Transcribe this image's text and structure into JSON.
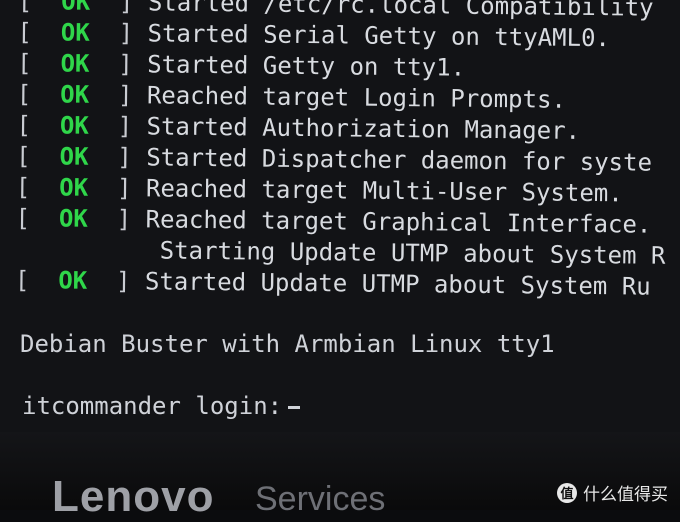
{
  "boot_lines": [
    {
      "status": "OK",
      "message": "Started /etc/rc.local Compatibility"
    },
    {
      "status": "OK",
      "message": "Started Serial Getty on ttyAML0."
    },
    {
      "status": "OK",
      "message": "Started Getty on tty1."
    },
    {
      "status": "OK",
      "message": "Reached target Login Prompts."
    },
    {
      "status": "OK",
      "message": "Started Authorization Manager."
    },
    {
      "status": "OK",
      "message": "Started Dispatcher daemon for syste"
    },
    {
      "status": "OK",
      "message": "Reached target Multi-User System."
    },
    {
      "status": "OK",
      "message": "Reached target Graphical Interface."
    },
    {
      "status": "",
      "message": "Starting Update UTMP about System R"
    },
    {
      "status": "OK",
      "message": "Started Update UTMP about System Ru"
    }
  ],
  "banner": "Debian Buster with Armbian Linux tty1",
  "login_prompt": "itcommander login:",
  "monitor": {
    "brand": "Lenovo",
    "sub": "Services"
  },
  "watermark": {
    "badge": "值",
    "text": "什么值得买"
  },
  "colors": {
    "ok": "#2fd64a",
    "text": "#d8dbe0",
    "background": "#121316"
  }
}
